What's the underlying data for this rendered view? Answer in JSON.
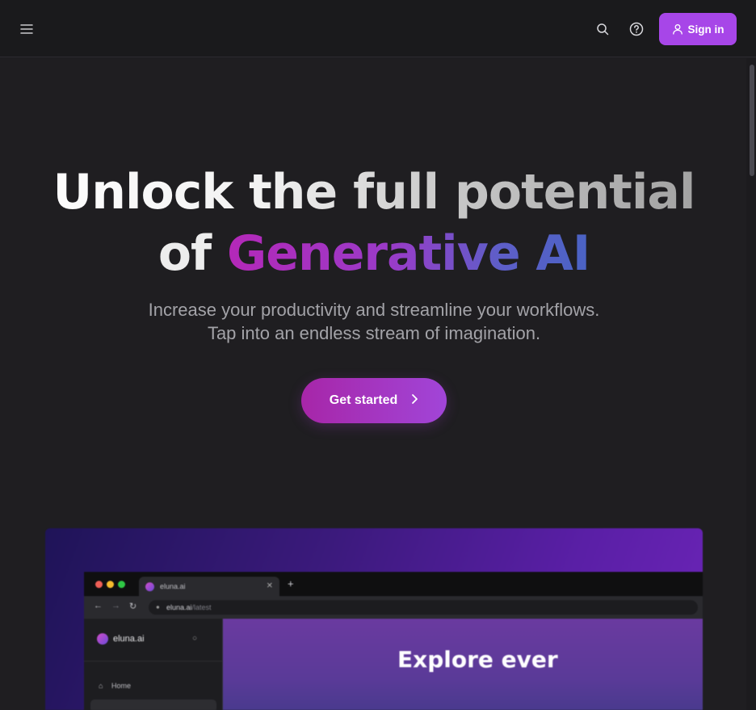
{
  "header": {
    "menu_icon": "hamburger-icon",
    "search_icon": "search-icon",
    "help_icon": "help-circle-icon",
    "signin_label": "Sign in",
    "signin_icon": "user-icon",
    "accent_color": "#a746e8"
  },
  "hero": {
    "title_line1": "Unlock the full potential",
    "title_of": "of",
    "title_highlight": "Generative AI",
    "subtitle_line1": "Increase your productivity and streamline your workflows.",
    "subtitle_line2": "Tap into an endless stream of imagination.",
    "cta_label": "Get started",
    "cta_icon": "chevron-right-icon"
  },
  "preview": {
    "tab_title": "eluna.ai",
    "url_host": "eluna.ai",
    "url_path": "/latest",
    "brand_name": "eluna.ai",
    "sidebar_home": "Home",
    "main_heading": "Explore ever"
  }
}
